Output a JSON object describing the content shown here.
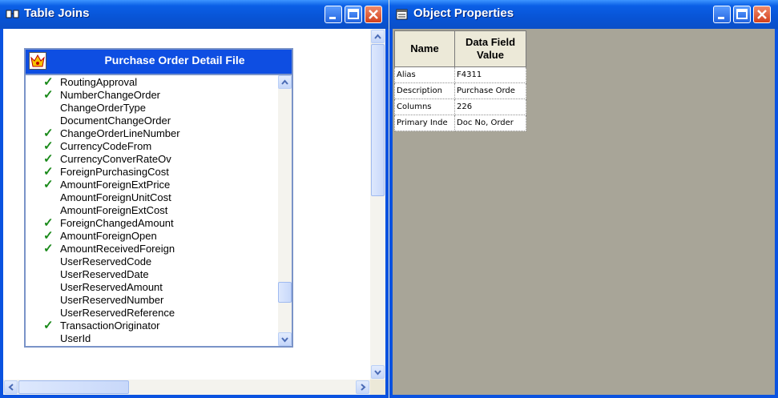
{
  "left_window": {
    "title": "Table Joins",
    "table_box": {
      "title": "Purchase Order Detail File",
      "fields": [
        {
          "label": "RoutingApproval",
          "checked": true
        },
        {
          "label": "NumberChangeOrder",
          "checked": true
        },
        {
          "label": "ChangeOrderType",
          "checked": false
        },
        {
          "label": "DocumentChangeOrder",
          "checked": false
        },
        {
          "label": "ChangeOrderLineNumber",
          "checked": true
        },
        {
          "label": "CurrencyCodeFrom",
          "checked": true
        },
        {
          "label": "CurrencyConverRateOv",
          "checked": true
        },
        {
          "label": "ForeignPurchasingCost",
          "checked": true
        },
        {
          "label": "AmountForeignExtPrice",
          "checked": true
        },
        {
          "label": "AmountForeignUnitCost",
          "checked": false
        },
        {
          "label": "AmountForeignExtCost",
          "checked": false
        },
        {
          "label": "ForeignChangedAmount",
          "checked": true
        },
        {
          "label": "AmountForeignOpen",
          "checked": true
        },
        {
          "label": "AmountReceivedForeign",
          "checked": true
        },
        {
          "label": "UserReservedCode",
          "checked": false
        },
        {
          "label": "UserReservedDate",
          "checked": false
        },
        {
          "label": "UserReservedAmount",
          "checked": false
        },
        {
          "label": "UserReservedNumber",
          "checked": false
        },
        {
          "label": "UserReservedReference",
          "checked": false
        },
        {
          "label": "TransactionOriginator",
          "checked": true
        },
        {
          "label": "UserId",
          "checked": false
        }
      ]
    }
  },
  "right_window": {
    "title": "Object Properties",
    "grid": {
      "headers": [
        "Name",
        "Data Field Value"
      ],
      "rows": [
        [
          "Alias",
          "F4311"
        ],
        [
          "Description",
          "Purchase Orde"
        ],
        [
          "Columns",
          "226"
        ],
        [
          "Primary Inde",
          "Doc No, Order"
        ]
      ]
    }
  },
  "colors": {
    "titlebar": "#0a52e0",
    "check": "#1a8a1a",
    "panel_gray": "#a8a598"
  },
  "check_glyph": "✓"
}
